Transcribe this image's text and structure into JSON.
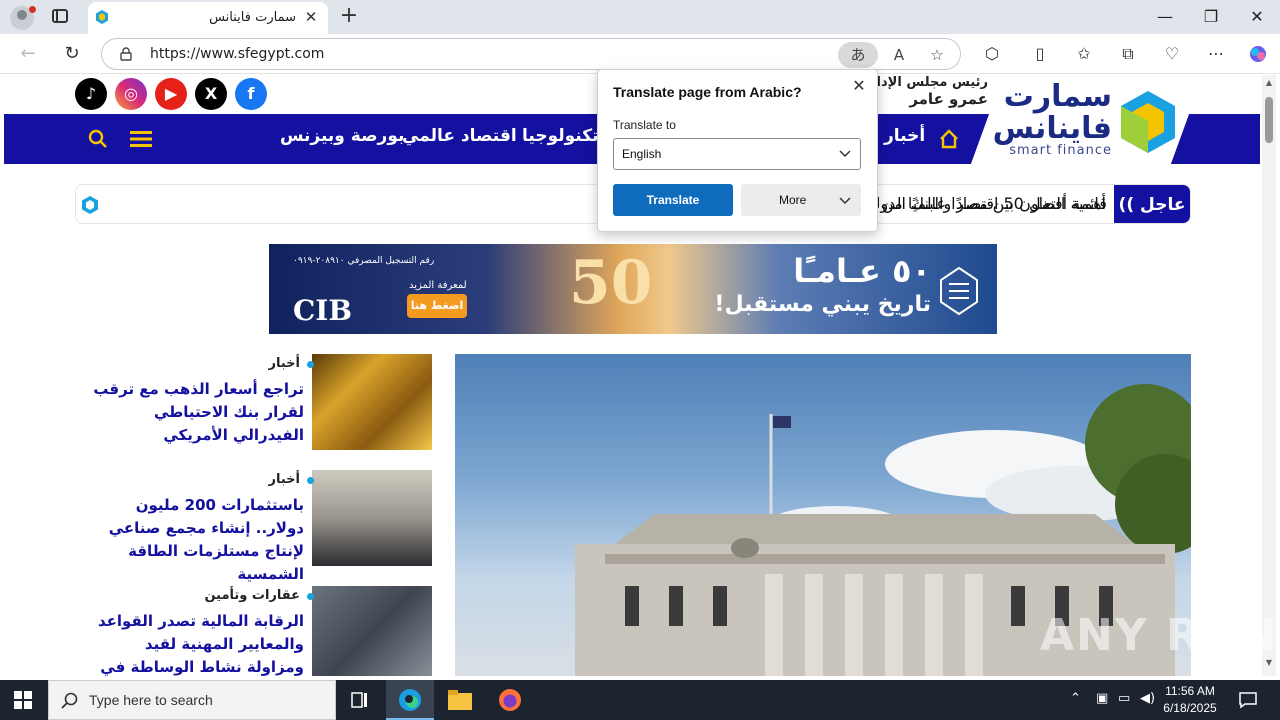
{
  "browser": {
    "tab_title": "سمارت فاينانس",
    "url": "https://www.sfegypt.com"
  },
  "site": {
    "logo_ar_line1": "سمارت",
    "logo_ar_line2": "فاينانس",
    "logo_en": "smart finance",
    "chair_label": "رئيس مجلس الإدارة",
    "chair_name": "عمرو عامر",
    "nav": [
      "أخبار",
      "وتكنولوجيا",
      "اقتصاد عالمي",
      "بورصة وبيزنس"
    ],
    "ticker_label": "عاجل",
    "ticker_text": "أهمية التعاون بين مصر والبنك الدولي لدفع جهود تحقيق الأمن الغذائي",
    "ticker_text_left": "قائمة أفضل 50 اقتصادًا عالميًا من",
    "banner": {
      "head": "٥٠ عـامـًا",
      "sub": "تاريخ يبني مستقبل!",
      "more": "لمعرفة المزيد",
      "button": "اضغط هنا",
      "brand": "CIB",
      "hotline": "رقم التسجيل المصرفي ٢٠٨٩١٠-٠٩١٩",
      "big_number": "50"
    },
    "news": [
      {
        "category": "أخبار",
        "title": "تراجع أسعار الذهب مع ترقب لقرار بنك الاحتياطي الفيدرالي الأمريكي"
      },
      {
        "category": "أخبار",
        "title": "باستثمارات 200 مليون دولار.. إنشاء مجمع صناعي لإنتاج مستلزمات الطاقة الشمسية"
      },
      {
        "category": "عقارات وتأمين",
        "title": "الرقابة المالية تصدر القواعد والمعايير المهنية لقيد ومزاولة نشاط الوساطة في التأمين أو"
      }
    ]
  },
  "translate_popup": {
    "title": "Translate page from Arabic?",
    "label": "Translate to",
    "selected": "English",
    "translate_btn": "Translate",
    "more_btn": "More"
  },
  "watermark": "ANY RUN",
  "taskbar": {
    "search_placeholder": "Type here to search",
    "time": "11:56 AM",
    "date": "6/18/2025"
  },
  "colors": {
    "brand_blue": "#1511a0",
    "accent_cyan": "#1aa1e0",
    "translate_blue": "#0f6cbd"
  }
}
